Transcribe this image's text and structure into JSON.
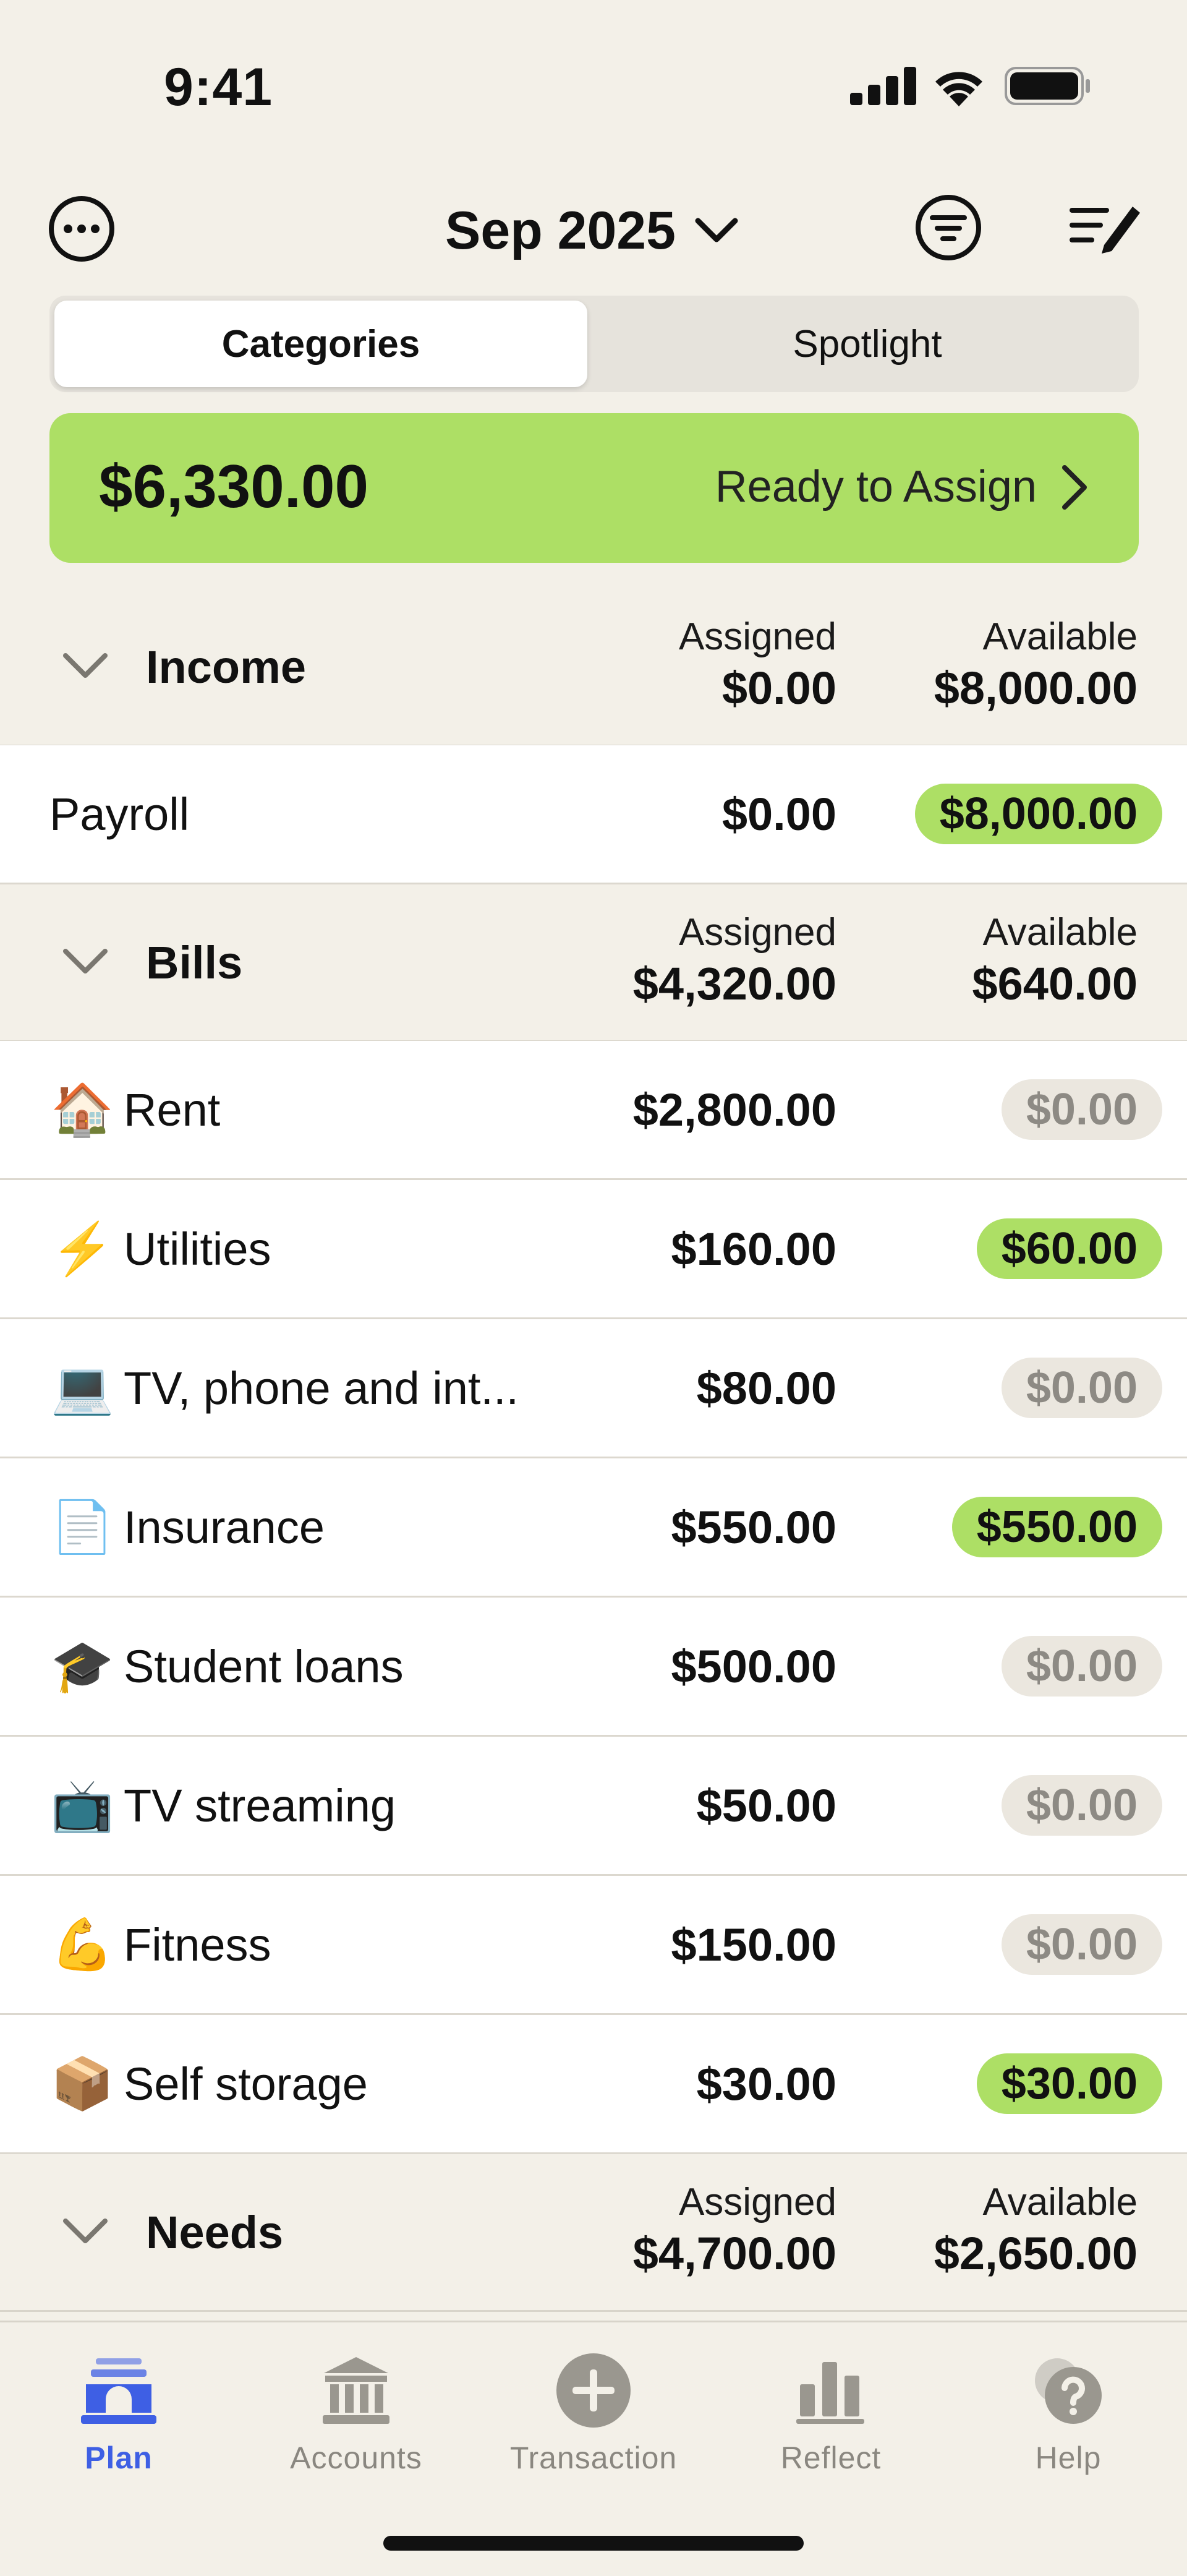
{
  "status_bar": {
    "time": "9:41"
  },
  "header": {
    "month": "Sep 2025"
  },
  "segments": {
    "active": "Categories",
    "inactive": "Spotlight"
  },
  "ready_to_assign": {
    "amount": "$6,330.00",
    "label": "Ready to Assign"
  },
  "groups": [
    {
      "name": "Income",
      "assigned_label": "Assigned",
      "assigned": "$0.00",
      "available_label": "Available",
      "available": "$8,000.00"
    },
    {
      "name": "Bills",
      "assigned_label": "Assigned",
      "assigned": "$4,320.00",
      "available_label": "Available",
      "available": "$640.00"
    },
    {
      "name": "Needs",
      "assigned_label": "Assigned",
      "assigned": "$4,700.00",
      "available_label": "Available",
      "available": "$2,650.00"
    }
  ],
  "rows": [
    {
      "icon": "",
      "name": "Payroll",
      "assigned": "$0.00",
      "available": "$8,000.00",
      "status": "green"
    },
    {
      "icon": "🏠",
      "name": "Rent",
      "assigned": "$2,800.00",
      "available": "$0.00",
      "status": "gray"
    },
    {
      "icon": "⚡",
      "name": "Utilities",
      "assigned": "$160.00",
      "available": "$60.00",
      "status": "green"
    },
    {
      "icon": "💻",
      "name": "TV, phone and int...",
      "assigned": "$80.00",
      "available": "$0.00",
      "status": "gray"
    },
    {
      "icon": "📄",
      "name": "Insurance",
      "assigned": "$550.00",
      "available": "$550.00",
      "status": "green"
    },
    {
      "icon": "🎓",
      "name": "Student loans",
      "assigned": "$500.00",
      "available": "$0.00",
      "status": "gray"
    },
    {
      "icon": "📺",
      "name": "TV streaming",
      "assigned": "$50.00",
      "available": "$0.00",
      "status": "gray"
    },
    {
      "icon": "💪",
      "name": "Fitness",
      "assigned": "$150.00",
      "available": "$0.00",
      "status": "gray"
    },
    {
      "icon": "📦",
      "name": "Self storage",
      "assigned": "$30.00",
      "available": "$30.00",
      "status": "green"
    }
  ],
  "tabs": [
    {
      "label": "Plan",
      "icon": "plan-icon"
    },
    {
      "label": "Accounts",
      "icon": "bank-icon"
    },
    {
      "label": "Transaction",
      "icon": "plus-circle-icon"
    },
    {
      "label": "Reflect",
      "icon": "bar-chart-icon"
    },
    {
      "label": "Help",
      "icon": "help-bubble-icon"
    }
  ],
  "colors": {
    "accent_green": "#addf65",
    "active_tab": "#3e5fe4",
    "background": "#f3f0e8"
  }
}
